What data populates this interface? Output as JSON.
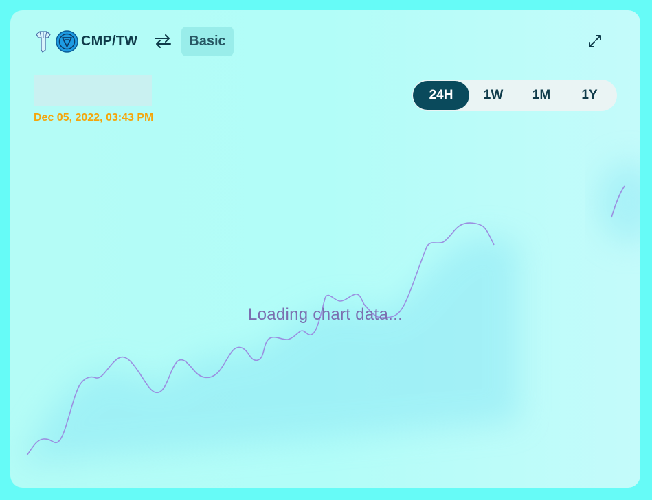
{
  "header": {
    "pair": "CMP/TW",
    "mode_label": "Basic",
    "icons": {
      "token1": "cmp-token-icon",
      "token2": "tw-token-icon",
      "swap": "swap-arrows-icon",
      "expand": "expand-icon"
    }
  },
  "price": {
    "timestamp": "Dec 05, 2022, 03:43 PM"
  },
  "ranges": {
    "items": [
      "24H",
      "1W",
      "1M",
      "1Y"
    ],
    "active": "24H"
  },
  "chart": {
    "loading_text": "Loading chart data...",
    "line_color": "#9b8fe0",
    "status": "loading"
  },
  "colors": {
    "background": "#66fbf7",
    "card": "#b4fcf6",
    "accent": "#0a4a5c",
    "timestamp": "#f5a50a"
  }
}
